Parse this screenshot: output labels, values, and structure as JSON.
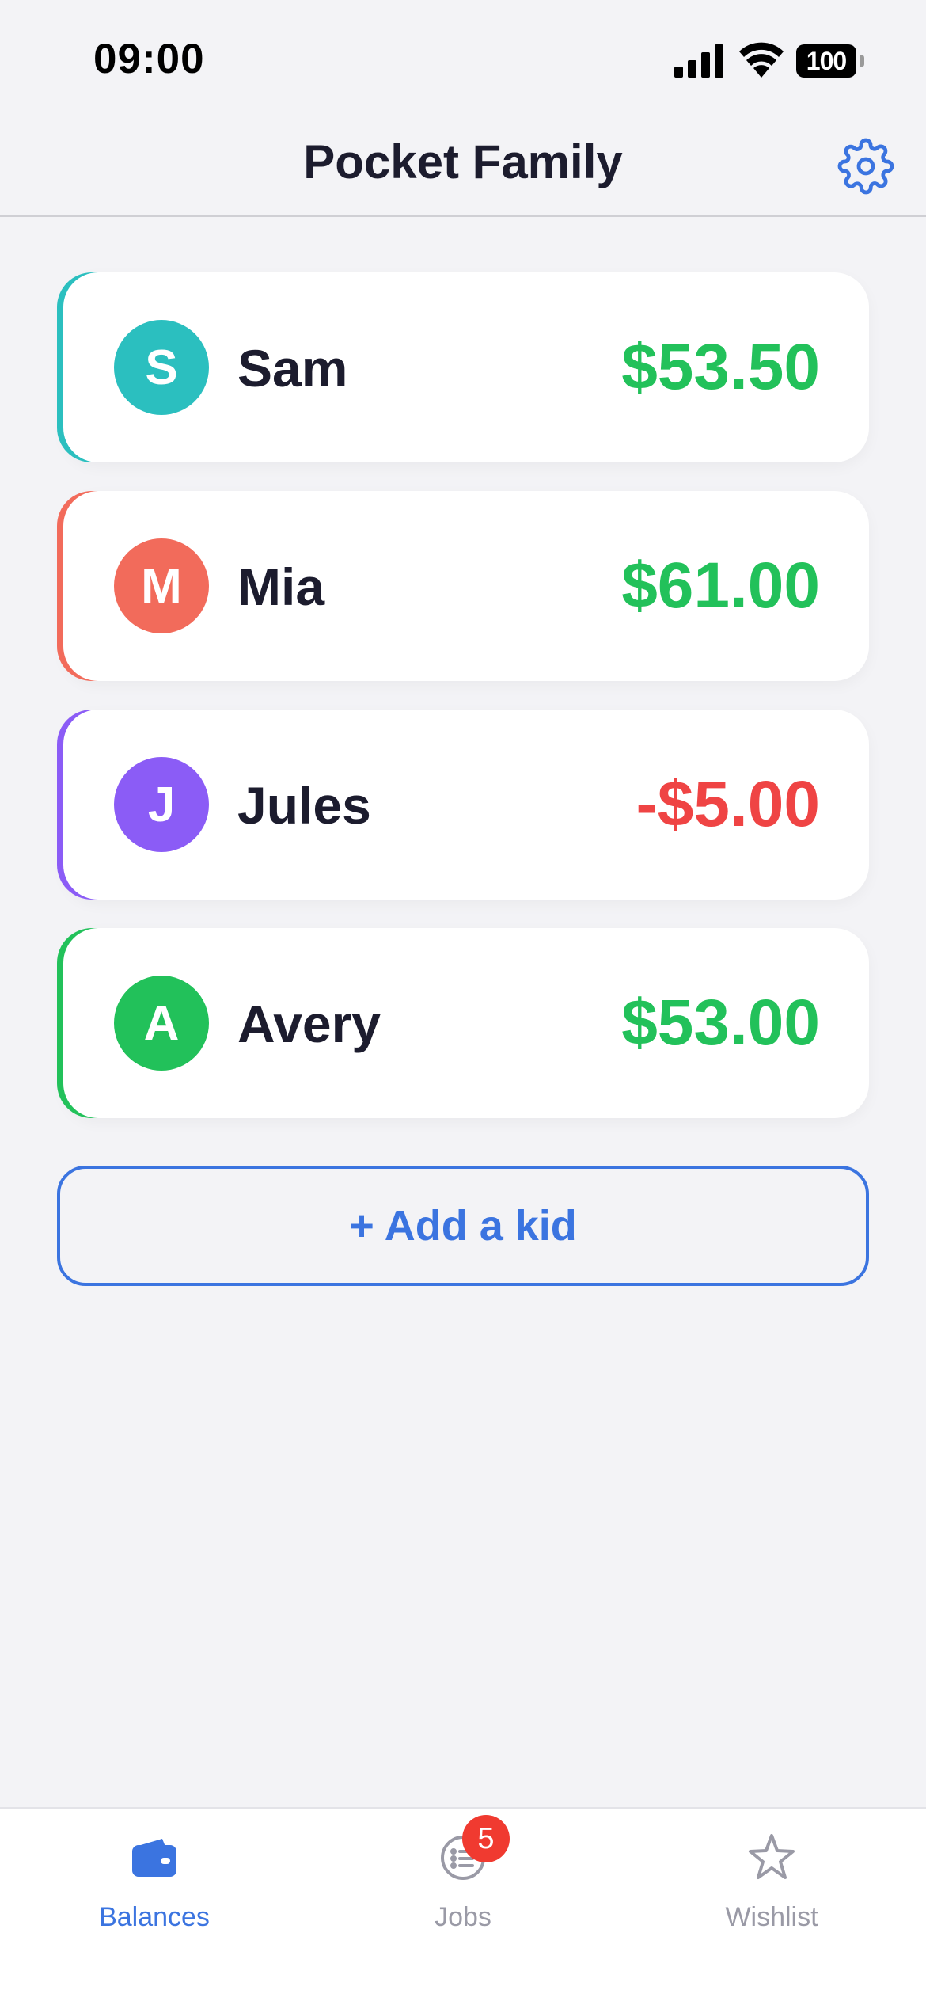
{
  "status_bar": {
    "time": "09:00",
    "battery": "100"
  },
  "header": {
    "title": "Pocket Family",
    "settings_icon": "gear-icon"
  },
  "kids": [
    {
      "initial": "S",
      "name": "Sam",
      "balance": "$53.50",
      "accent": "#2bbfbf",
      "balance_color": "#22c15a"
    },
    {
      "initial": "M",
      "name": "Mia",
      "balance": "$61.00",
      "accent": "#f26b5b",
      "balance_color": "#22c15a"
    },
    {
      "initial": "J",
      "name": "Jules",
      "balance": "-$5.00",
      "accent": "#8b5cf6",
      "balance_color": "#ef4444"
    },
    {
      "initial": "A",
      "name": "Avery",
      "balance": "$53.00",
      "accent": "#22c15a",
      "balance_color": "#22c15a"
    }
  ],
  "add_kid_label": "+ Add a kid",
  "tabs": [
    {
      "label": "Balances",
      "icon": "wallet-icon",
      "active": true
    },
    {
      "label": "Jobs",
      "icon": "jobs-list-icon",
      "badge": "5",
      "active": false
    },
    {
      "label": "Wishlist",
      "icon": "star-icon",
      "active": false
    }
  ],
  "colors": {
    "accent": "#3b74e0",
    "inactive": "#9a9aa6",
    "badge": "#f03a30"
  }
}
